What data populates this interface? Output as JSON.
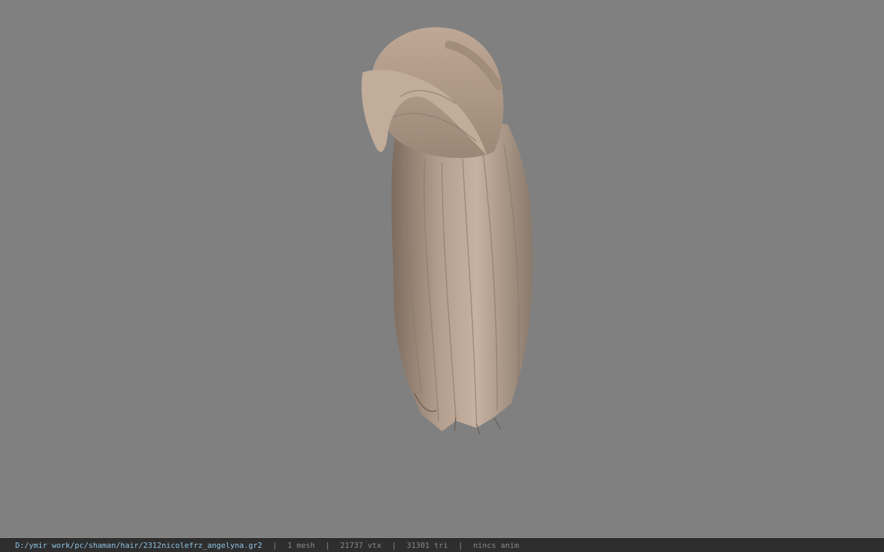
{
  "viewport": {
    "background": "#808080",
    "model_name": "hair-mesh"
  },
  "statusbar": {
    "path": "D:/ymir work/pc/shaman/hair/2312nicolefrz_angelyna.gr2",
    "separator": "|",
    "mesh_count": "1 mesh",
    "vertex_count": "21737 vtx",
    "triangle_count": "31301 tri",
    "anim_status": "nincs anim",
    "path_color": "#8fc3e6",
    "stat_color": "#8a8a8a"
  }
}
